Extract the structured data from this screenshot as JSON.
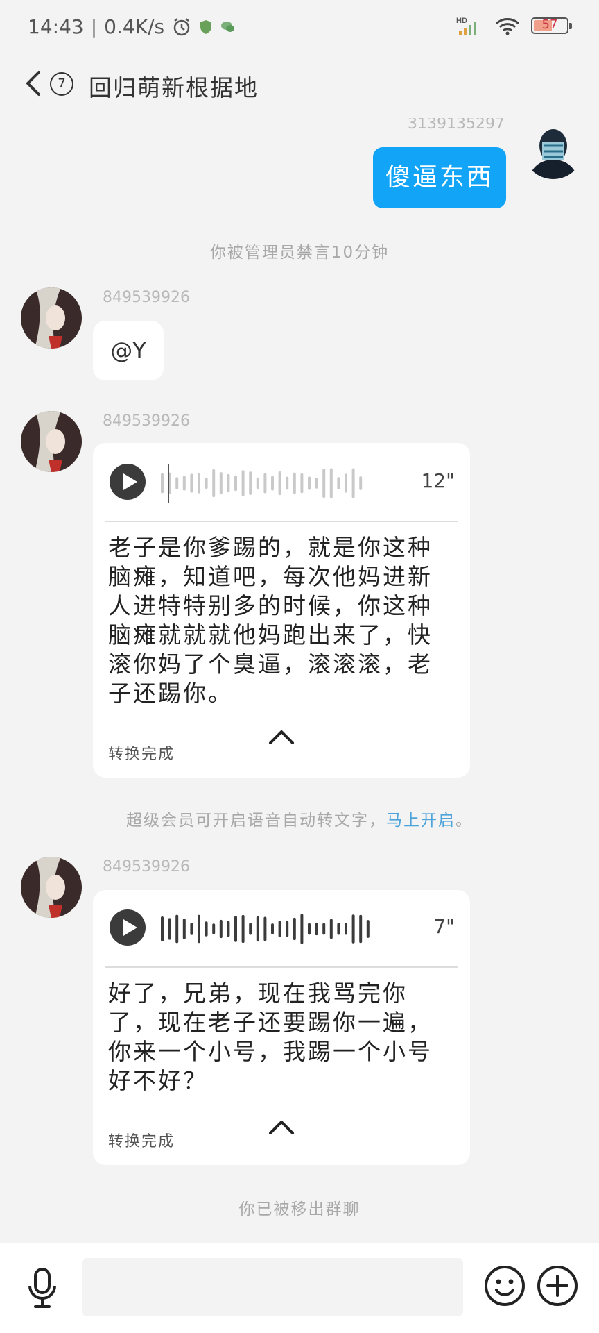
{
  "status_bar": {
    "time": "14:43",
    "net_speed": "0.4K/s",
    "signal_label": "HD",
    "battery": "57"
  },
  "header": {
    "unread_count": "7",
    "title": "回归萌新根据地"
  },
  "messages": {
    "me": {
      "sender_id": "3139135297",
      "text": "傻逼东西"
    },
    "sys_mute": "你被管理员禁言10分钟",
    "msg1": {
      "sender_id": "849539926",
      "text": "@Y"
    },
    "voice1": {
      "sender_id": "849539926",
      "duration": "12\"",
      "transcript": "老子是你爹踢的，就是你这种脑瘫，知道吧，每次他妈进新人进特特别多的时候，你这种脑瘫就就就他妈跑出来了，快滚你妈了个臭逼，滚滚滚，老子还踢你。",
      "status": "转换完成"
    },
    "sys_vip": {
      "text": "超级会员可开启语音自动转文字，",
      "link": "马上开启",
      "end": "。"
    },
    "voice2": {
      "sender_id": "849539926",
      "duration": "7\"",
      "transcript": "好了，兄弟，现在我骂完你了，现在老子还要踢你一遍，你来一个小号，我踢一个小号好不好？",
      "status": "转换完成"
    },
    "sys_removed": "你已被移出群聊"
  },
  "input_bar": {
    "placeholder": ""
  },
  "colors": {
    "accent": "#12a4f7",
    "background": "#f3f3f3",
    "link": "#4da4db"
  }
}
